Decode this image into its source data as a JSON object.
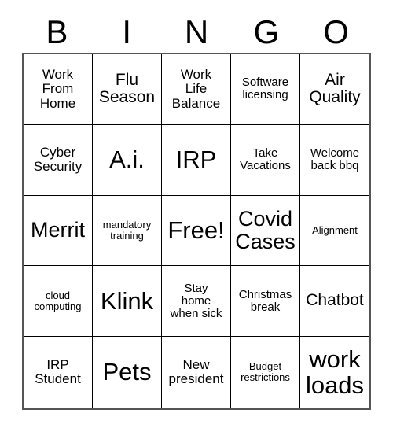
{
  "card": {
    "header_letters": [
      "B",
      "I",
      "N",
      "G",
      "O"
    ],
    "colors": {
      "background": "#ffffff",
      "text": "#000000",
      "cell_border": "#000000",
      "outer_border": "#555555"
    },
    "rows": [
      [
        {
          "text": "Work\nFrom\nHome",
          "size": "m"
        },
        {
          "text": "Flu\nSeason",
          "size": "l"
        },
        {
          "text": "Work\nLife\nBalance",
          "size": "m"
        },
        {
          "text": "Software\nlicensing",
          "size": "s"
        },
        {
          "text": "Air\nQuality",
          "size": "l"
        }
      ],
      [
        {
          "text": "Cyber\nSecurity",
          "size": "m"
        },
        {
          "text": "A.i.",
          "size": "xxl"
        },
        {
          "text": "IRP",
          "size": "xxl"
        },
        {
          "text": "Take\nVacations",
          "size": "s"
        },
        {
          "text": "Welcome\nback bbq",
          "size": "s"
        }
      ],
      [
        {
          "text": "Merrit",
          "size": "xl"
        },
        {
          "text": "mandatory\ntraining",
          "size": "xs"
        },
        {
          "text": "Free!",
          "size": "xxl"
        },
        {
          "text": "Covid\nCases",
          "size": "xl"
        },
        {
          "text": "Alignment",
          "size": "xs"
        }
      ],
      [
        {
          "text": "cloud\ncomputing",
          "size": "xs"
        },
        {
          "text": "Klink",
          "size": "xxl"
        },
        {
          "text": "Stay\nhome\nwhen sick",
          "size": "s"
        },
        {
          "text": "Christmas\nbreak",
          "size": "s"
        },
        {
          "text": "Chatbot",
          "size": "l"
        }
      ],
      [
        {
          "text": "IRP\nStudent",
          "size": "m"
        },
        {
          "text": "Pets",
          "size": "xxl"
        },
        {
          "text": "New\npresident",
          "size": "m"
        },
        {
          "text": "Budget\nrestrictions",
          "size": "xs"
        },
        {
          "text": "work\nloads",
          "size": "xxl"
        }
      ]
    ]
  }
}
